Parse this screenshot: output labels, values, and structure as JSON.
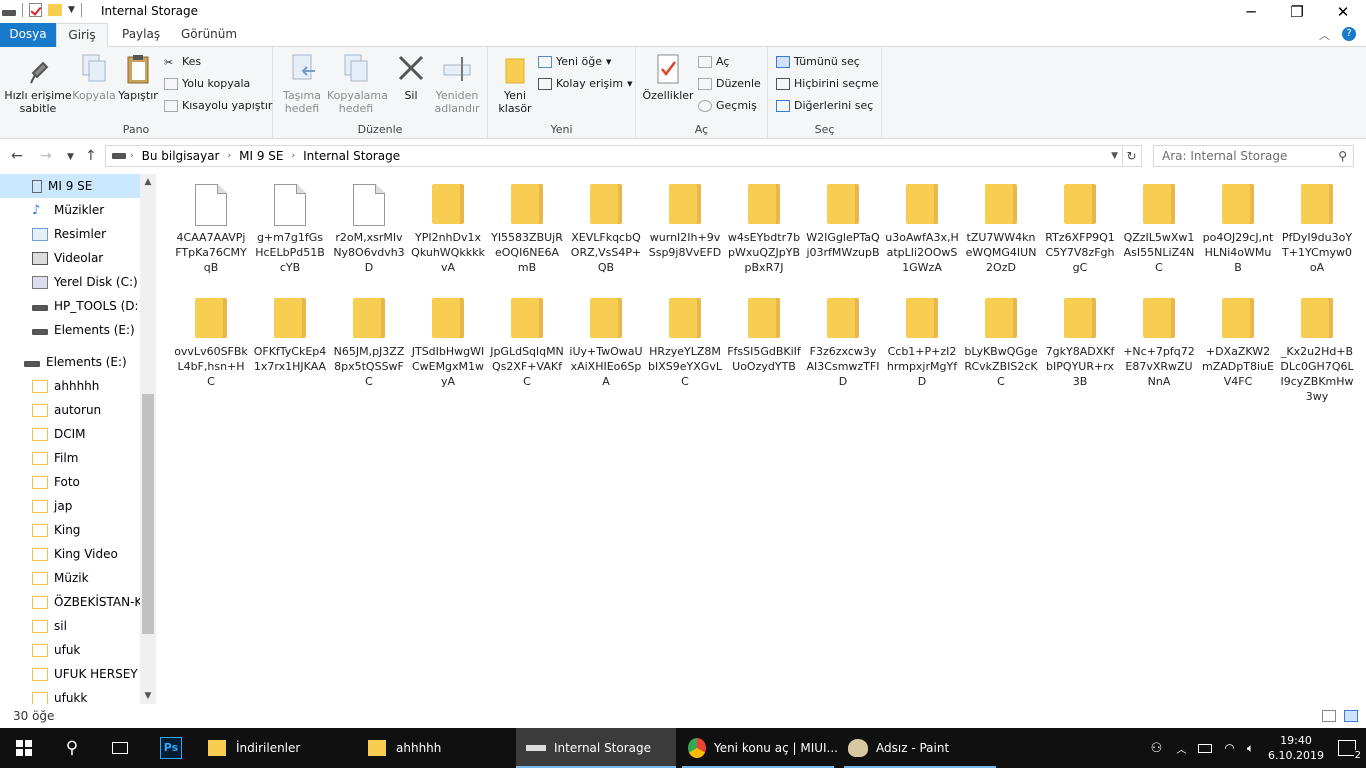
{
  "window": {
    "title": "Internal Storage",
    "buttons": {
      "minimize": "─",
      "maximize": "❐",
      "close": "✕"
    }
  },
  "menu": {
    "file": "Dosya",
    "tabs": [
      "Giriş",
      "Paylaş",
      "Görünüm"
    ]
  },
  "ribbon": {
    "pano": {
      "label": "Pano",
      "pin": "Hızlı erişime sabitle",
      "copy": "Kopyala",
      "paste": "Yapıştır",
      "cut": "Kes",
      "copy_path": "Yolu kopyala",
      "paste_shortcut": "Kısayolu yapıştır"
    },
    "duzenle": {
      "label": "Düzenle",
      "move": "Taşıma hedefi",
      "copyto": "Kopyalama hedefi",
      "delete": "Sil",
      "rename": "Yeniden adlandır"
    },
    "yeni": {
      "label": "Yeni",
      "new_folder": "Yeni klasör",
      "new_item": "Yeni öğe",
      "easy_access": "Kolay erişim"
    },
    "ac": {
      "label": "Aç",
      "properties": "Özellikler",
      "open": "Aç",
      "edit": "Düzenle",
      "history": "Geçmiş"
    },
    "sec": {
      "label": "Seç",
      "select_all": "Tümünü seç",
      "select_none": "Hiçbirini seçme",
      "invert": "Diğerlerini seç"
    }
  },
  "address": {
    "crumbs": [
      "Bu bilgisayar",
      "MI 9 SE",
      "Internal Storage"
    ],
    "search_placeholder": "Ara: Internal Storage"
  },
  "sidebar": {
    "items": [
      "MI 9 SE",
      "Müzikler",
      "Resimler",
      "Videolar",
      "Yerel Disk (C:)",
      "HP_TOOLS (D:)",
      "Elements (E:)",
      "Elements (E:)",
      "ahhhhh",
      "autorun",
      "DCIM",
      "Film",
      "Foto",
      "jap",
      "King",
      "King Video",
      "Müzik",
      "ÖZBEKİSTAN-KII",
      "sil",
      "ufuk",
      "UFUK HERSEY",
      "ufukk"
    ]
  },
  "files": [
    {
      "name": "4CAA7AAVPjFTpKa76CMYqB",
      "type": "file"
    },
    {
      "name": "g+m7g1fGsHcELbPd51BcYB",
      "type": "file"
    },
    {
      "name": "r2oM,xsrMIvNy8O6vdvh3D",
      "type": "file"
    },
    {
      "name": "YPI2nhDv1xQkuhWQkkkkvA",
      "type": "folder"
    },
    {
      "name": "YI5583ZBUjReOQI6NE6AmB",
      "type": "folder"
    },
    {
      "name": "XEVLFkqcbQORZ,VsS4P+QB",
      "type": "folder"
    },
    {
      "name": "wurnI2Ih+9vSsp9j8VvEFD",
      "type": "folder"
    },
    {
      "name": "w4sEYbdtr7bpWxuQZJpYBpBxR7J",
      "type": "folder"
    },
    {
      "name": "W2IGglePTaQj03rfMWzupB",
      "type": "folder"
    },
    {
      "name": "u3oAwfA3x,HatpLIi2OOwS1GWzA",
      "type": "folder"
    },
    {
      "name": "tZU7WW4kneWQMG4IUN2OzD",
      "type": "folder"
    },
    {
      "name": "RTz6XFP9Q1C5Y7V8zFghgC",
      "type": "folder"
    },
    {
      "name": "QZzIL5wXw1AsI55NLiZ4NC",
      "type": "folder"
    },
    {
      "name": "po4OJ29cJ,ntHLNi4oWMuB",
      "type": "folder"
    },
    {
      "name": "PfDyI9du3oYT+1YCmyw0oA",
      "type": "folder"
    },
    {
      "name": "ovvLv60SFBkL4bF,hsn+HC",
      "type": "folder"
    },
    {
      "name": "OFKfTyCkEp41x7rx1HJKAA",
      "type": "folder"
    },
    {
      "name": "N65JM,pJ3ZZ8px5tQSSwFC",
      "type": "folder"
    },
    {
      "name": "JTSdIbHwgWICwEMgxM1wyA",
      "type": "folder"
    },
    {
      "name": "JpGLdSqlqMNQs2XF+VAKfC",
      "type": "folder"
    },
    {
      "name": "iUy+TwOwaUxAiXHIEo6SpA",
      "type": "folder"
    },
    {
      "name": "HRzyeYLZ8MbIXS9eYXGvLC",
      "type": "folder"
    },
    {
      "name": "FfsSI5GdBKiIfUoOzydYTB",
      "type": "folder"
    },
    {
      "name": "F3z6zxcw3yAI3CsmwzTFID",
      "type": "folder"
    },
    {
      "name": "Ccb1+P+zI2hrmpxjrMgYfD",
      "type": "folder"
    },
    {
      "name": "bLyKBwQGgeRCvkZBIS2cKC",
      "type": "folder"
    },
    {
      "name": "7gkY8ADXKfbIPQYUR+rx3B",
      "type": "folder"
    },
    {
      "name": "+Nc+7pfq72E87vXRwZUNnA",
      "type": "folder"
    },
    {
      "name": "+DXaZKW2mZADpT8iuEV4FC",
      "type": "folder"
    },
    {
      "name": "_Kx2u2Hd+BDLc0GH7Q6LI9cyZBKmHw3wy",
      "type": "folder"
    }
  ],
  "status": {
    "count": "30 öğe"
  },
  "taskbar": {
    "apps": [
      "İndirilenler",
      "ahhhhh",
      "Internal Storage",
      "Yeni konu aç | MIUI...",
      "Adsız - Paint"
    ],
    "time": "19:40",
    "date": "6.10.2019",
    "notif_count": "2"
  }
}
